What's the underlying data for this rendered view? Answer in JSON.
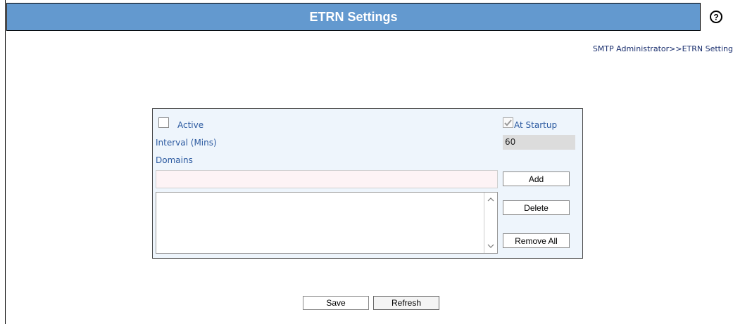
{
  "header": {
    "title": "ETRN Settings",
    "help_icon": "question-circle-icon"
  },
  "breadcrumb": "SMTP Administrator>>ETRN Setting",
  "form": {
    "active": {
      "label": "Active",
      "checked": false
    },
    "at_startup": {
      "label": "At Startup",
      "checked": true
    },
    "interval": {
      "label": "Interval (Mins)",
      "value": "60"
    },
    "domains": {
      "label": "Domains",
      "input_value": "",
      "items": []
    },
    "buttons": {
      "add": "Add",
      "delete": "Delete",
      "remove_all": "Remove All"
    }
  },
  "footer": {
    "save": "Save",
    "refresh": "Refresh"
  },
  "colors": {
    "title_bar": "#6399cf",
    "panel_bg": "#eef5fc",
    "label": "#2c5aa0"
  }
}
